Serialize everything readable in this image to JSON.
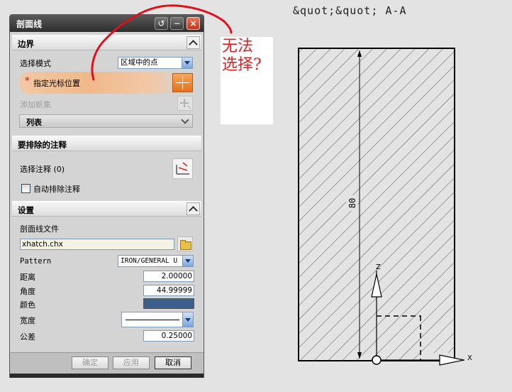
{
  "dialog": {
    "title": "剖面线",
    "title_buttons": [
      "reset-icon",
      "minimize-icon",
      "close-icon"
    ],
    "boundary": {
      "header": "边界",
      "select_mode_label": "选择模式",
      "select_mode_value": "区域中的点",
      "specify_cursor_label": "指定光标位置",
      "add_new_set_label": "添加新集",
      "list_label": "列表"
    },
    "exclude": {
      "header": "要排除的注释",
      "select_annotation_label": "选择注释 (0)",
      "auto_exclude_label": "自动排除注释",
      "auto_exclude_checked": false
    },
    "settings": {
      "header": "设置",
      "hatch_file_label": "剖面线文件",
      "hatch_file_value": "xhatch.chx",
      "pattern_label": "Pattern",
      "pattern_value": "IRON/GENERAL U",
      "distance_label": "距离",
      "distance_value": "2.00000",
      "angle_label": "角度",
      "angle_value": "44.99999",
      "color_label": "颜色",
      "color_value": "#3c5f8e",
      "width_label": "宽度",
      "tolerance_label": "公差",
      "tolerance_value": "0.25000"
    },
    "buttons": {
      "ok": "确定",
      "apply": "应用",
      "cancel": "取消"
    }
  },
  "annotation": {
    "line1": "无法",
    "line2": "选择?",
    "color": "#e02020"
  },
  "view": {
    "section_label": "&quot;&quot; A-A",
    "dimension_text": "80",
    "axis_z": "Z",
    "axis_x": "X"
  }
}
